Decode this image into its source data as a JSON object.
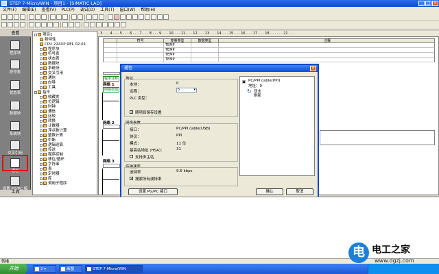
{
  "window": {
    "title": "STEP 7-Micro/WIN - 项目1 - [SIMATIC LAD]"
  },
  "menu": [
    "文件(F)",
    "编辑(E)",
    "查看(V)",
    "PLC(P)",
    "调试(D)",
    "工具(T)",
    "窗口(W)",
    "帮助(H)"
  ],
  "nav": {
    "header": "查看",
    "items": [
      "程序块",
      "符号表",
      "状态表",
      "数据块",
      "系统块",
      "交叉引用",
      "通信",
      "设置 PG/PC 接口"
    ],
    "footer": "工具"
  },
  "tree": {
    "items": [
      "项目1",
      "新特性",
      "CPU 224XP REL 02.01",
      "程序块",
      "符号表",
      "状态表",
      "数据块",
      "系统块",
      "交叉引用",
      "通信",
      "向导",
      "工具",
      "指令",
      "收藏夹",
      "位逻辑",
      "时钟",
      "通信",
      "比较",
      "转换",
      "计数器",
      "浮点数计算",
      "整数计算",
      "中断",
      "逻辑运算",
      "传送",
      "程序控制",
      "移位/循环",
      "字符串",
      "表",
      "定时器",
      "库",
      "调用子程序"
    ]
  },
  "ruler": "· 3 · · · 4 · · · 5 · · · 6 · · · 7 · · · 8 · · · 9 · · · 10 · · · 11 · · · 12 · · · 13 · · · 14 · · · 15 · · · 16 · · · 17 · · · 18 · · · · · · 21 · · ·",
  "var_table": {
    "headers": [
      "符号",
      "变量类型",
      "数据类型",
      "注释"
    ],
    "rows": [
      [
        "",
        "TEMP",
        "",
        ""
      ],
      [
        "",
        "TEMP",
        "",
        ""
      ],
      [
        "",
        "TEMP",
        "",
        ""
      ],
      [
        "",
        "TEMP",
        "",
        ""
      ]
    ]
  },
  "editor": {
    "program_comment": "程序注释",
    "network1": "网络 1",
    "network_title": "网络标题",
    "network2": "网络 2",
    "network3": "网络 3"
  },
  "dialog": {
    "title": "通信",
    "address_group": "地址",
    "local_label": "本地：",
    "local_value": "0",
    "remote_label": "远程：",
    "remote_value": "5",
    "plc_type_label": "PLC 类型：",
    "save_with_project": "随项目保存设置",
    "net_params_group": "网络参数",
    "interface_label": "接口：",
    "interface_value": "PC/PPI cable(USB)",
    "protocol_label": "协议：",
    "protocol_value": "PPI",
    "mode_label": "模式：",
    "mode_value": "11 位",
    "hsa_label": "最高站地址 (HSA)：",
    "hsa_value": "31",
    "multi_master": "支持多主站",
    "rate_group": "传输速率",
    "baud_label": "波特率",
    "baud_value": "9.6 kbps",
    "search_all": "搜索所有波特率",
    "setup_button": "设置 PG/PC 接口",
    "cable_line1": "PC/PPI cable(PPI)",
    "cable_line2": "地址：0",
    "double_click": "双击",
    "refresh": "刷新",
    "ok": "确认",
    "cancel": "取消"
  },
  "status": {
    "left": "就绪"
  },
  "taskbar": {
    "start": "开始",
    "items": [
      "2 ▾",
      "画图",
      "STEP 7-Micro/WIN"
    ]
  },
  "watermark": {
    "logo": "电",
    "name": "电工之家",
    "url": "www.dgzj.com"
  }
}
